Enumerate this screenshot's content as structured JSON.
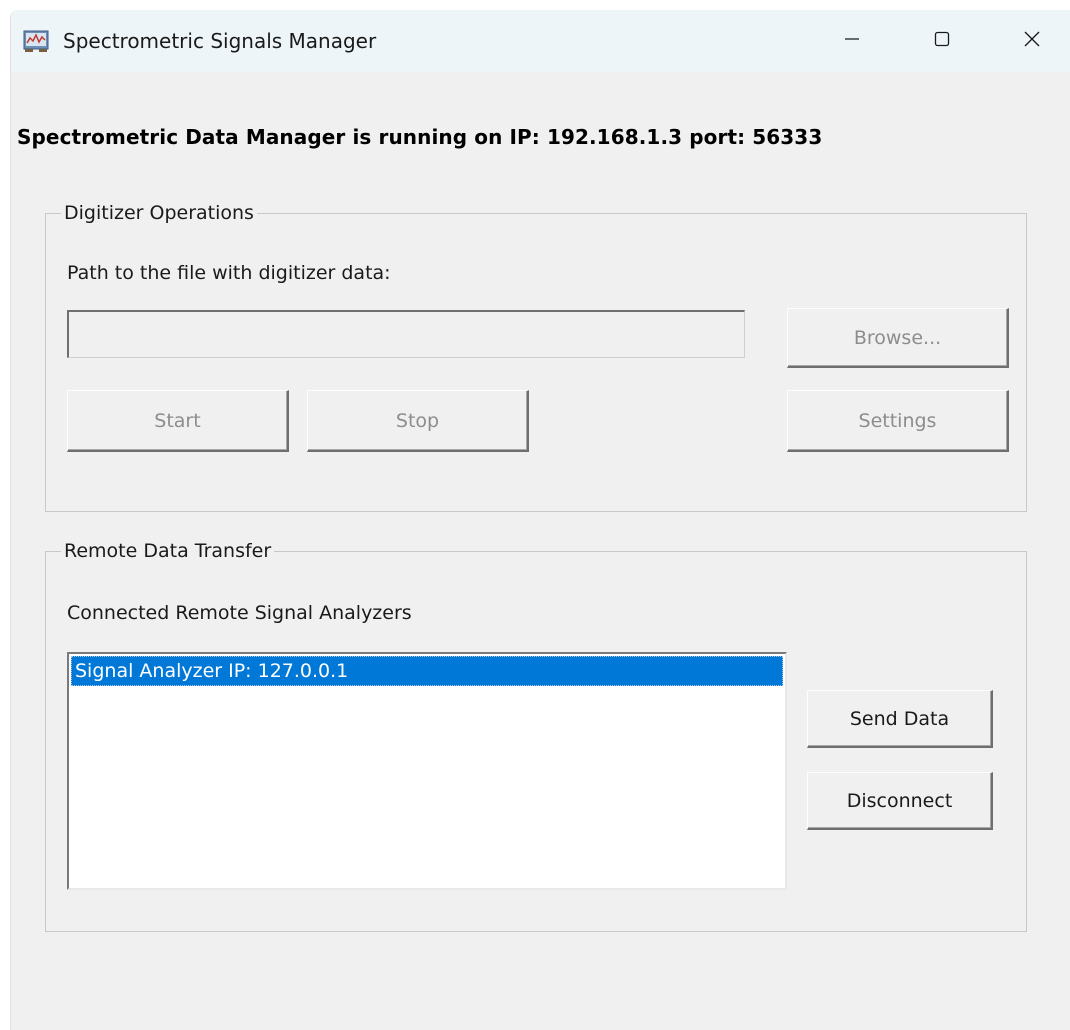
{
  "window": {
    "title": "Spectrometric Signals Manager",
    "controls": {
      "minimize": "minimize-icon",
      "maximize": "maximize-icon",
      "close": "close-icon"
    }
  },
  "status_text": "Spectrometric Data Manager is running on IP: 192.168.1.3 port: 56333",
  "digitizer": {
    "group_label": "Digitizer Operations",
    "path_label": "Path to the file with digitizer data:",
    "path_value": "",
    "browse_label": "Browse...",
    "start_label": "Start",
    "stop_label": "Stop",
    "settings_label": "Settings"
  },
  "remote": {
    "group_label": "Remote Data Transfer",
    "list_label": "Connected Remote Signal Analyzers",
    "analyzers": [
      "Signal Analyzer IP: 127.0.0.1"
    ],
    "send_label": "Send Data",
    "disconnect_label": "Disconnect"
  },
  "colors": {
    "selection": "#0078d7",
    "window_bg": "#f0f0f0",
    "titlebar_bg": "#eef5f8",
    "disabled_text": "#8d8d8d"
  }
}
